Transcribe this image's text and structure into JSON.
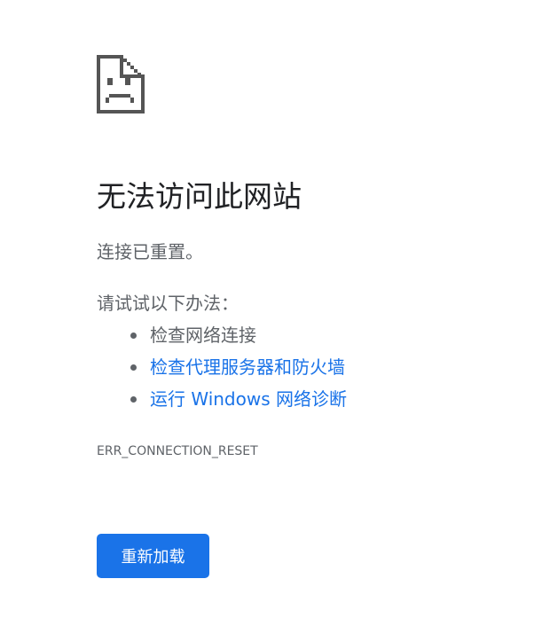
{
  "error": {
    "icon": "sad-page-icon",
    "title": "无法访问此网站",
    "subtitle": "连接已重置。",
    "suggestions_heading": "请试试以下办法：",
    "suggestions": [
      {
        "label": "检查网络连接",
        "is_link": false
      },
      {
        "label": "检查代理服务器和防火墙",
        "is_link": true
      },
      {
        "label": "运行 Windows 网络诊断",
        "is_link": true
      }
    ],
    "code": "ERR_CONNECTION_RESET",
    "reload_label": "重新加载"
  },
  "colors": {
    "title": "#202124",
    "secondary_text": "#5f6368",
    "link": "#1a73e8",
    "button_bg": "#1a73e8",
    "button_text": "#ffffff",
    "icon": "#555555"
  }
}
